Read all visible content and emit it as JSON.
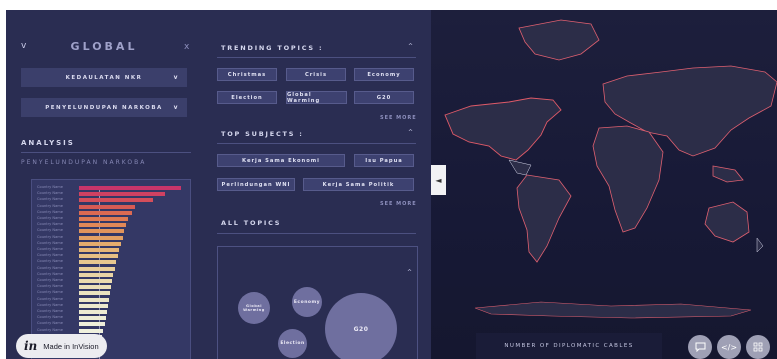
{
  "left": {
    "title": "GLOBAL",
    "chevron": "v",
    "close": "x",
    "dropdowns": [
      {
        "label": "KEDAULATAN NKR",
        "caret": "v"
      },
      {
        "label": "PENYELUNDUPAN NARKOBA",
        "caret": "v"
      }
    ],
    "analysis_label": "ANALYSIS",
    "analysis_subtitle": "PENYELUNDUPAN NARKOBA"
  },
  "chart_data": {
    "type": "bar",
    "orientation": "horizontal",
    "categories": [
      "Country Name",
      "Country Name",
      "Country Name",
      "Country Name",
      "Country Name",
      "Country Name",
      "Country Name",
      "Country Name",
      "Country Name",
      "Country Name",
      "Country Name",
      "Country Name",
      "Country Name",
      "Country Name",
      "Country Name",
      "Country Name",
      "Country Name",
      "Country Name",
      "Country Name",
      "Country Name",
      "Country Name",
      "Country Name",
      "Country Name",
      "Country Name",
      "Country Name",
      "Country Name",
      "Country Name",
      "Country Name"
    ],
    "values": [
      100,
      84,
      73,
      55,
      52,
      48,
      46,
      44,
      43,
      41,
      39,
      38,
      36,
      35,
      33,
      32,
      31,
      30,
      29,
      28,
      27,
      26,
      25,
      24,
      23,
      23,
      22,
      21
    ],
    "colors": [
      "#c9356a",
      "#cf4162",
      "#d44e5b",
      "#d85b54",
      "#dc6a52",
      "#df7a53",
      "#e18857",
      "#e2955c",
      "#e3a164",
      "#e4ac6d",
      "#e5b679",
      "#e6bf84",
      "#e7c78f",
      "#e8ce9a",
      "#e9d4a5",
      "#eadaaf",
      "#ebdfb8",
      "#ebe3c0",
      "#ece6c7",
      "#ede9cd",
      "#eeebd2",
      "#eeedd6",
      "#efefda",
      "#eff0dd",
      "#f0f1e0",
      "#f0f2e2",
      "#f1f3e4",
      "#f1f3e6"
    ],
    "xlim": [
      0,
      100
    ]
  },
  "right": {
    "trending_label": "TRENDING TOPICS :",
    "trending_caret": "^",
    "trending": [
      "Christmas",
      "Crisis",
      "Economy",
      "Election",
      "Global Warming",
      "G20"
    ],
    "see_more": "SEE MORE",
    "top_subjects_label": "TOP SUBJECTS :",
    "top_subjects_caret": "^",
    "top_subjects": [
      "Kerja Sama Ekonomi",
      "Isu Papua",
      "Perlindungan WNI",
      "Kerja Sama Politik"
    ],
    "all_topics_label": "ALL TOPICS",
    "all_topics_caret": "^",
    "bubbles": [
      "Global Warming",
      "Economy",
      "Election",
      "G20"
    ]
  },
  "map": {
    "toggle_icon": "◄",
    "cables_label": "NUMBER OF DIPLOMATIC CABLES"
  },
  "footer": {
    "invision_logo": "in",
    "invision_text": "Made in InVision"
  }
}
